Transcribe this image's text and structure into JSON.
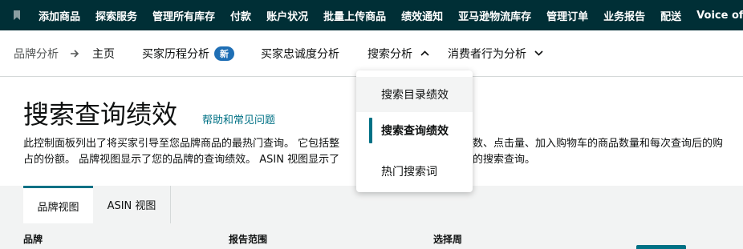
{
  "topnav": {
    "items": [
      "添加商品",
      "探索服务",
      "管理所有库存",
      "付款",
      "账户状况",
      "批量上传商品",
      "绩效通知",
      "亚马逊物流库存",
      "管理订单",
      "业务报告",
      "配送",
      "Voice of"
    ]
  },
  "subnav": {
    "breadcrumb": "品牌分析",
    "home": "主页",
    "buyer_journey": "买家历程分析",
    "new_badge": "新",
    "loyalty": "买家忠诚度分析",
    "search_analytics": "搜索分析",
    "consumer_behavior": "消费者行为分析"
  },
  "dropdown": {
    "items": [
      "搜索目录绩效",
      "搜索查询绩效",
      "热门搜索词"
    ]
  },
  "page": {
    "title": "搜索查询绩效",
    "help_link": "帮助和常见问题",
    "desc_line1": "此控制面板列出了将买家引导至您品牌商品的最热门查询。 它包括整",
    "desc_line1_right": "数、点击量、加入购物车的商品数量和每次查询后的购",
    "desc_line2": "占的份额。 品牌视图显示了您的品牌的查询绩效。 ASIN 视图显示了",
    "desc_line2_right": "的搜索查询。"
  },
  "tabs": [
    "品牌视图",
    "ASIN 视图"
  ],
  "filters": {
    "brand_label": "品牌",
    "range_label": "报告范围",
    "week_label": "选择周"
  }
}
